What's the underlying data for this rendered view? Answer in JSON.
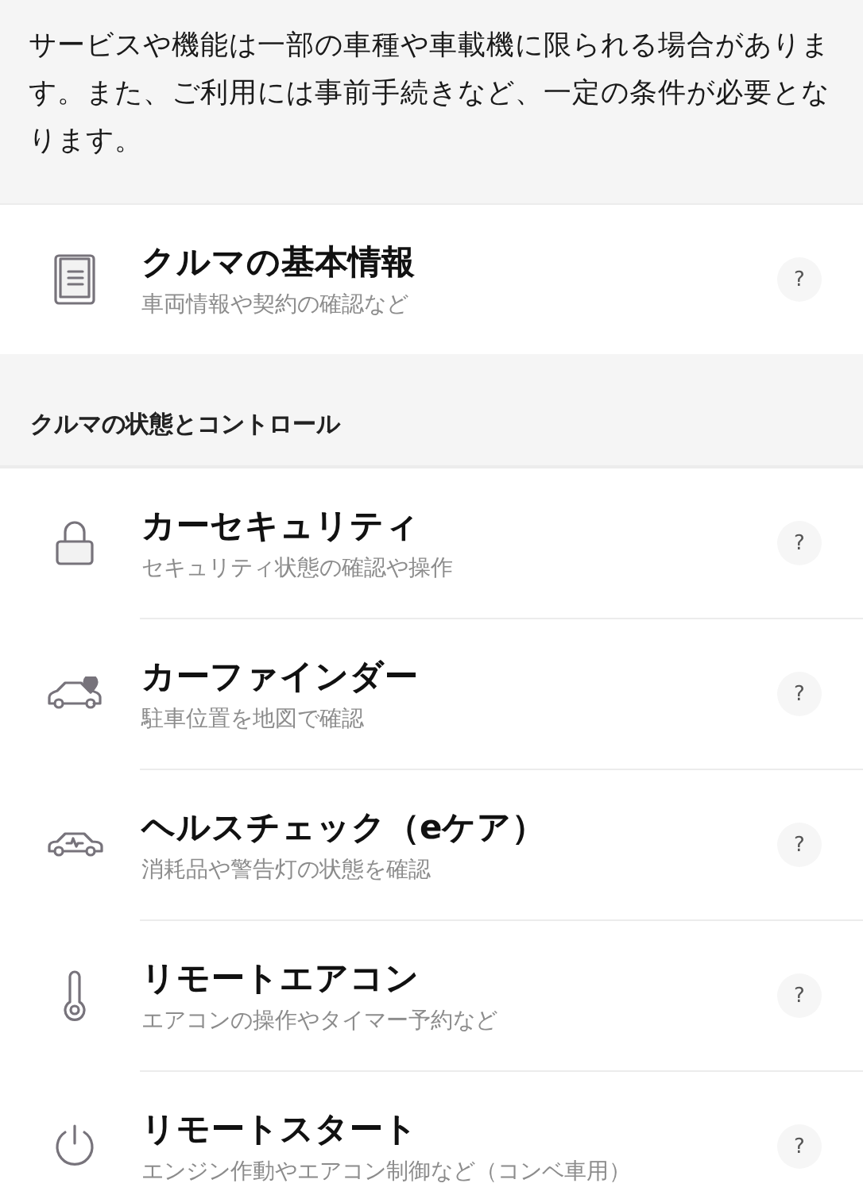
{
  "notice": "サービスや機能は一部の車種や車載機に限られる場合があります。また、ご利用には事前手続きなど、一定の条件が必要となります。",
  "basic": {
    "kind": "document",
    "title": "クルマの基本情報",
    "subtitle": "車両情報や契約の確認など",
    "help": "?"
  },
  "section": {
    "title": "クルマの状態とコントロール",
    "items": [
      {
        "kind": "lock",
        "title": "カーセキュリティ",
        "subtitle": "セキュリティ状態の確認や操作",
        "help": "?"
      },
      {
        "kind": "car-pin",
        "title": "カーファインダー",
        "subtitle": "駐車位置を地図で確認",
        "help": "?"
      },
      {
        "kind": "car-pulse",
        "title": "ヘルスチェック（eケア）",
        "subtitle": "消耗品や警告灯の状態を確認",
        "help": "?"
      },
      {
        "kind": "thermometer",
        "title": "リモートエアコン",
        "subtitle": "エアコンの操作やタイマー予約など",
        "help": "?"
      },
      {
        "kind": "power",
        "title": "リモートスタート",
        "subtitle": "エンジン作動やエアコン制御など（コンベ車用）",
        "help": "?"
      }
    ]
  }
}
